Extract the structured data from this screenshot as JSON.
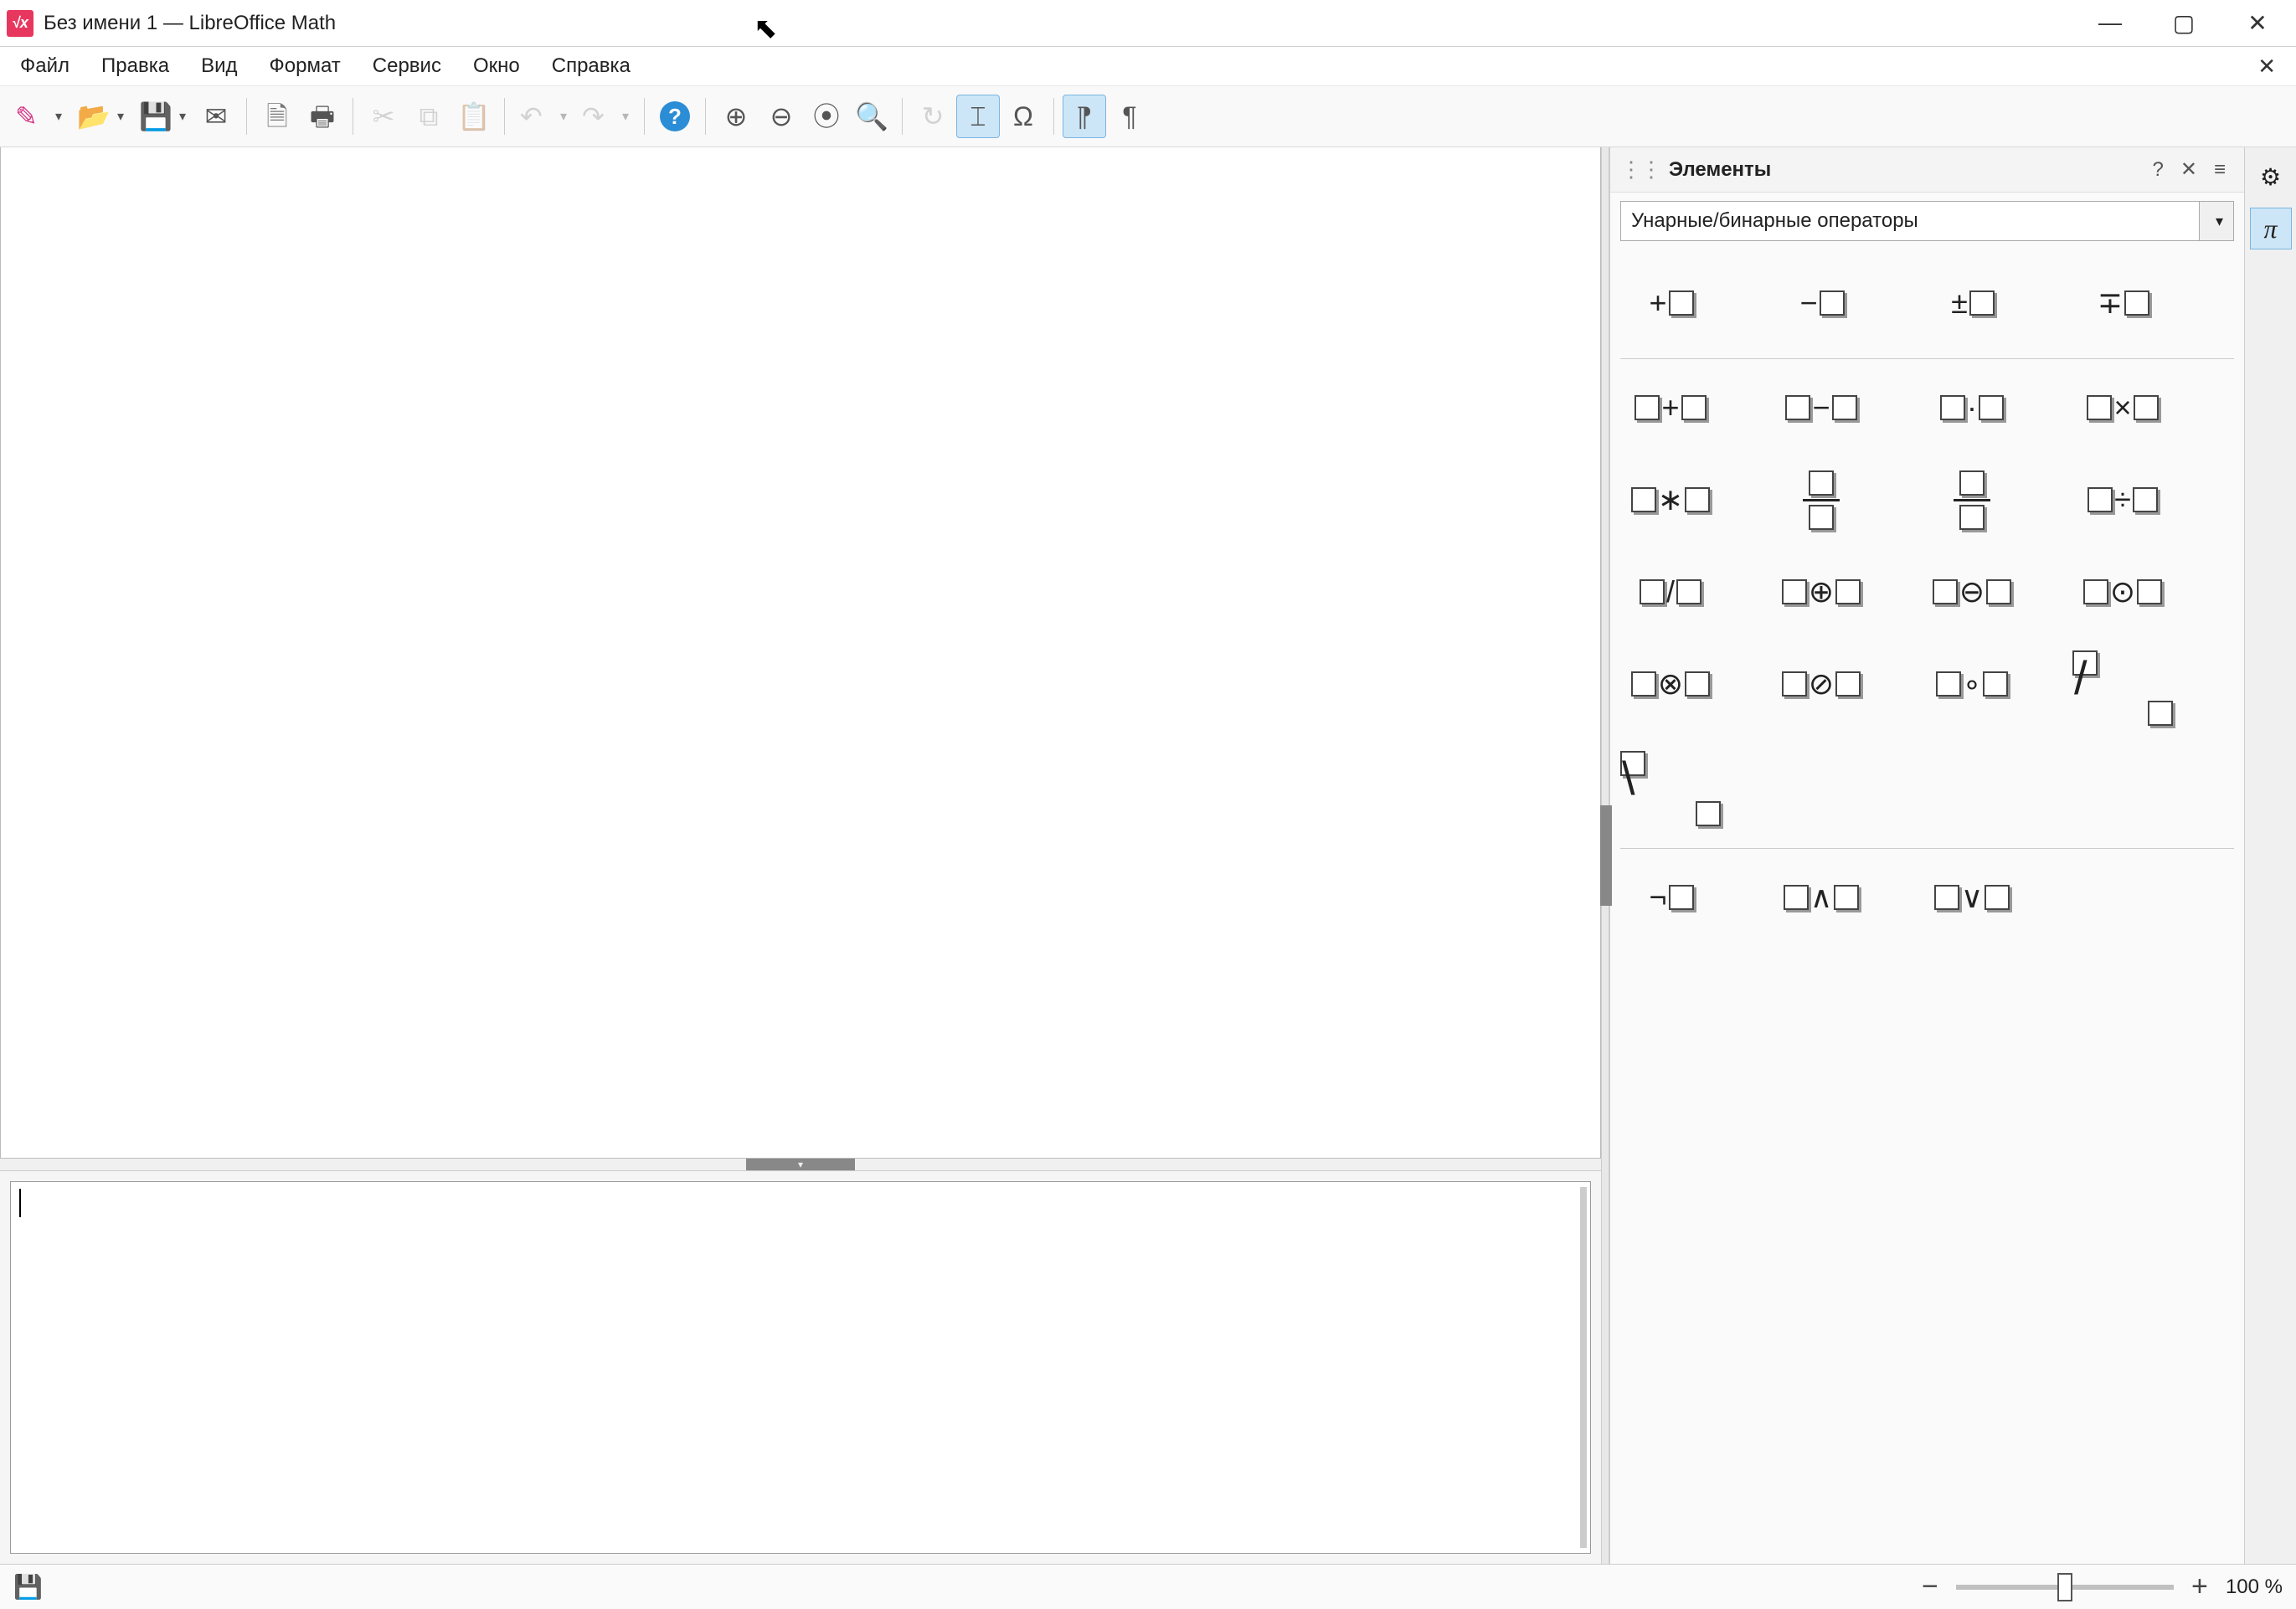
{
  "window": {
    "title": "Без имени 1 — LibreOffice Math",
    "app_icon_text": "√x"
  },
  "menu": {
    "items": [
      "Файл",
      "Правка",
      "Вид",
      "Формат",
      "Сервис",
      "Окно",
      "Справка"
    ]
  },
  "toolbar": {
    "buttons": [
      {
        "name": "new-doc",
        "glyph": "✎",
        "color": "#d63384",
        "dropdown": true
      },
      {
        "name": "open",
        "glyph": "📂",
        "color": "#e8a33d",
        "dropdown": true
      },
      {
        "name": "save",
        "glyph": "💾",
        "color": "#a646c4",
        "dropdown": true
      },
      {
        "name": "mail",
        "glyph": "✉",
        "color": "#555"
      },
      {
        "sep": true
      },
      {
        "name": "export-pdf",
        "glyph": "🗎",
        "color": "#777"
      },
      {
        "name": "print",
        "glyph": "🖶",
        "color": "#555"
      },
      {
        "sep": true
      },
      {
        "name": "cut",
        "glyph": "✂",
        "color": "#999",
        "disabled": true
      },
      {
        "name": "copy",
        "glyph": "⧉",
        "color": "#999",
        "disabled": true
      },
      {
        "name": "paste",
        "glyph": "📋",
        "color": "#999",
        "disabled": true
      },
      {
        "sep": true
      },
      {
        "name": "undo",
        "glyph": "↶",
        "color": "#999",
        "dropdown": true,
        "disabled": true
      },
      {
        "name": "redo",
        "glyph": "↷",
        "color": "#999",
        "dropdown": true,
        "disabled": true
      },
      {
        "sep": true
      },
      {
        "name": "help",
        "glyph": "?",
        "color": "#2b8dd6",
        "circle": true
      },
      {
        "sep": true
      },
      {
        "name": "zoom-in",
        "glyph": "⊕",
        "color": "#555"
      },
      {
        "name": "zoom-out",
        "glyph": "⊖",
        "color": "#555"
      },
      {
        "name": "zoom-100",
        "glyph": "⦿",
        "color": "#555"
      },
      {
        "name": "zoom-fit",
        "glyph": "🔍",
        "color": "#d68a2b"
      },
      {
        "sep": true
      },
      {
        "name": "refresh",
        "glyph": "↻",
        "color": "#999",
        "disabled": true
      },
      {
        "name": "formula-cursor",
        "glyph": "⌶",
        "color": "#555",
        "active": true
      },
      {
        "name": "symbols",
        "glyph": "Ω",
        "color": "#555"
      },
      {
        "sep": true
      },
      {
        "name": "format-left",
        "glyph": "¶",
        "color": "#555",
        "flip": true,
        "active": true
      },
      {
        "name": "format-right",
        "glyph": "¶",
        "color": "#555"
      }
    ]
  },
  "elements_panel": {
    "title": "Элементы",
    "dropdown_value": "Унарные/бинарные операторы",
    "sections": [
      {
        "name": "unary",
        "items": [
          {
            "name": "plus",
            "pre": "+",
            "ph": 1
          },
          {
            "name": "minus",
            "pre": "−",
            "ph": 1
          },
          {
            "name": "plusminus",
            "pre": "±",
            "ph": 1
          },
          {
            "name": "minusplus",
            "pre": "∓",
            "ph": 1
          }
        ]
      },
      {
        "name": "binary-arith",
        "items": [
          {
            "name": "add",
            "ph": 2,
            "mid": "+"
          },
          {
            "name": "sub",
            "ph": 2,
            "mid": "−"
          },
          {
            "name": "cdot",
            "ph": 2,
            "mid": "·"
          },
          {
            "name": "times",
            "ph": 2,
            "mid": "×"
          },
          {
            "name": "ast",
            "ph": 2,
            "mid": "∗"
          },
          {
            "name": "frac1",
            "frac": true
          },
          {
            "name": "frac2",
            "frac": true
          },
          {
            "name": "div",
            "ph": 2,
            "mid": "÷"
          },
          {
            "name": "slash",
            "ph": 2,
            "mid": "/"
          },
          {
            "name": "oplus",
            "ph": 2,
            "mid": "⊕"
          },
          {
            "name": "ominus",
            "ph": 2,
            "mid": "⊖"
          },
          {
            "name": "odot",
            "ph": 2,
            "mid": "⊙"
          },
          {
            "name": "otimes",
            "ph": 2,
            "mid": "⊗"
          },
          {
            "name": "oslash",
            "ph": 2,
            "mid": "⊘"
          },
          {
            "name": "circ",
            "ph": 2,
            "mid": "∘"
          },
          {
            "name": "wideslash",
            "diag": "/"
          },
          {
            "name": "widebslash",
            "diag": "\\"
          }
        ]
      },
      {
        "name": "logical",
        "items": [
          {
            "name": "neg",
            "pre": "¬",
            "ph": 1
          },
          {
            "name": "and",
            "ph": 2,
            "mid": "∧"
          },
          {
            "name": "or",
            "ph": 2,
            "mid": "∨"
          }
        ]
      }
    ]
  },
  "statusbar": {
    "zoom_text": "100 %"
  }
}
